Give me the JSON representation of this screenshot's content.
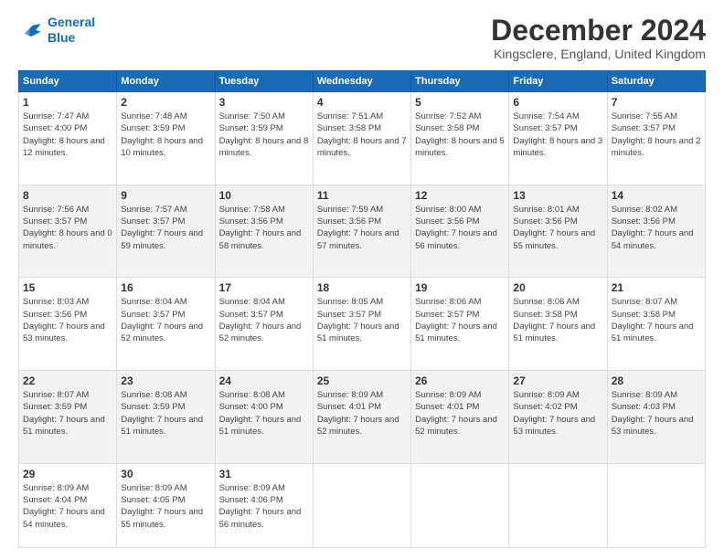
{
  "logo": {
    "line1": "General",
    "line2": "Blue"
  },
  "title": "December 2024",
  "subtitle": "Kingsclere, England, United Kingdom",
  "days_of_week": [
    "Sunday",
    "Monday",
    "Tuesday",
    "Wednesday",
    "Thursday",
    "Friday",
    "Saturday"
  ],
  "weeks": [
    [
      {
        "day": "1",
        "sunrise": "7:47 AM",
        "sunset": "4:00 PM",
        "daylight": "8 hours and 12 minutes."
      },
      {
        "day": "2",
        "sunrise": "7:48 AM",
        "sunset": "3:59 PM",
        "daylight": "8 hours and 10 minutes."
      },
      {
        "day": "3",
        "sunrise": "7:50 AM",
        "sunset": "3:59 PM",
        "daylight": "8 hours and 8 minutes."
      },
      {
        "day": "4",
        "sunrise": "7:51 AM",
        "sunset": "3:58 PM",
        "daylight": "8 hours and 7 minutes."
      },
      {
        "day": "5",
        "sunrise": "7:52 AM",
        "sunset": "3:58 PM",
        "daylight": "8 hours and 5 minutes."
      },
      {
        "day": "6",
        "sunrise": "7:54 AM",
        "sunset": "3:57 PM",
        "daylight": "8 hours and 3 minutes."
      },
      {
        "day": "7",
        "sunrise": "7:55 AM",
        "sunset": "3:57 PM",
        "daylight": "8 hours and 2 minutes."
      }
    ],
    [
      {
        "day": "8",
        "sunrise": "7:56 AM",
        "sunset": "3:57 PM",
        "daylight": "8 hours and 0 minutes."
      },
      {
        "day": "9",
        "sunrise": "7:57 AM",
        "sunset": "3:57 PM",
        "daylight": "7 hours and 59 minutes."
      },
      {
        "day": "10",
        "sunrise": "7:58 AM",
        "sunset": "3:56 PM",
        "daylight": "7 hours and 58 minutes."
      },
      {
        "day": "11",
        "sunrise": "7:59 AM",
        "sunset": "3:56 PM",
        "daylight": "7 hours and 57 minutes."
      },
      {
        "day": "12",
        "sunrise": "8:00 AM",
        "sunset": "3:56 PM",
        "daylight": "7 hours and 56 minutes."
      },
      {
        "day": "13",
        "sunrise": "8:01 AM",
        "sunset": "3:56 PM",
        "daylight": "7 hours and 55 minutes."
      },
      {
        "day": "14",
        "sunrise": "8:02 AM",
        "sunset": "3:56 PM",
        "daylight": "7 hours and 54 minutes."
      }
    ],
    [
      {
        "day": "15",
        "sunrise": "8:03 AM",
        "sunset": "3:56 PM",
        "daylight": "7 hours and 53 minutes."
      },
      {
        "day": "16",
        "sunrise": "8:04 AM",
        "sunset": "3:57 PM",
        "daylight": "7 hours and 52 minutes."
      },
      {
        "day": "17",
        "sunrise": "8:04 AM",
        "sunset": "3:57 PM",
        "daylight": "7 hours and 52 minutes."
      },
      {
        "day": "18",
        "sunrise": "8:05 AM",
        "sunset": "3:57 PM",
        "daylight": "7 hours and 51 minutes."
      },
      {
        "day": "19",
        "sunrise": "8:06 AM",
        "sunset": "3:57 PM",
        "daylight": "7 hours and 51 minutes."
      },
      {
        "day": "20",
        "sunrise": "8:06 AM",
        "sunset": "3:58 PM",
        "daylight": "7 hours and 51 minutes."
      },
      {
        "day": "21",
        "sunrise": "8:07 AM",
        "sunset": "3:58 PM",
        "daylight": "7 hours and 51 minutes."
      }
    ],
    [
      {
        "day": "22",
        "sunrise": "8:07 AM",
        "sunset": "3:59 PM",
        "daylight": "7 hours and 51 minutes."
      },
      {
        "day": "23",
        "sunrise": "8:08 AM",
        "sunset": "3:59 PM",
        "daylight": "7 hours and 51 minutes."
      },
      {
        "day": "24",
        "sunrise": "8:08 AM",
        "sunset": "4:00 PM",
        "daylight": "7 hours and 51 minutes."
      },
      {
        "day": "25",
        "sunrise": "8:09 AM",
        "sunset": "4:01 PM",
        "daylight": "7 hours and 52 minutes."
      },
      {
        "day": "26",
        "sunrise": "8:09 AM",
        "sunset": "4:01 PM",
        "daylight": "7 hours and 52 minutes."
      },
      {
        "day": "27",
        "sunrise": "8:09 AM",
        "sunset": "4:02 PM",
        "daylight": "7 hours and 53 minutes."
      },
      {
        "day": "28",
        "sunrise": "8:09 AM",
        "sunset": "4:03 PM",
        "daylight": "7 hours and 53 minutes."
      }
    ],
    [
      {
        "day": "29",
        "sunrise": "8:09 AM",
        "sunset": "4:04 PM",
        "daylight": "7 hours and 54 minutes."
      },
      {
        "day": "30",
        "sunrise": "8:09 AM",
        "sunset": "4:05 PM",
        "daylight": "7 hours and 55 minutes."
      },
      {
        "day": "31",
        "sunrise": "8:09 AM",
        "sunset": "4:06 PM",
        "daylight": "7 hours and 56 minutes."
      },
      null,
      null,
      null,
      null
    ]
  ]
}
